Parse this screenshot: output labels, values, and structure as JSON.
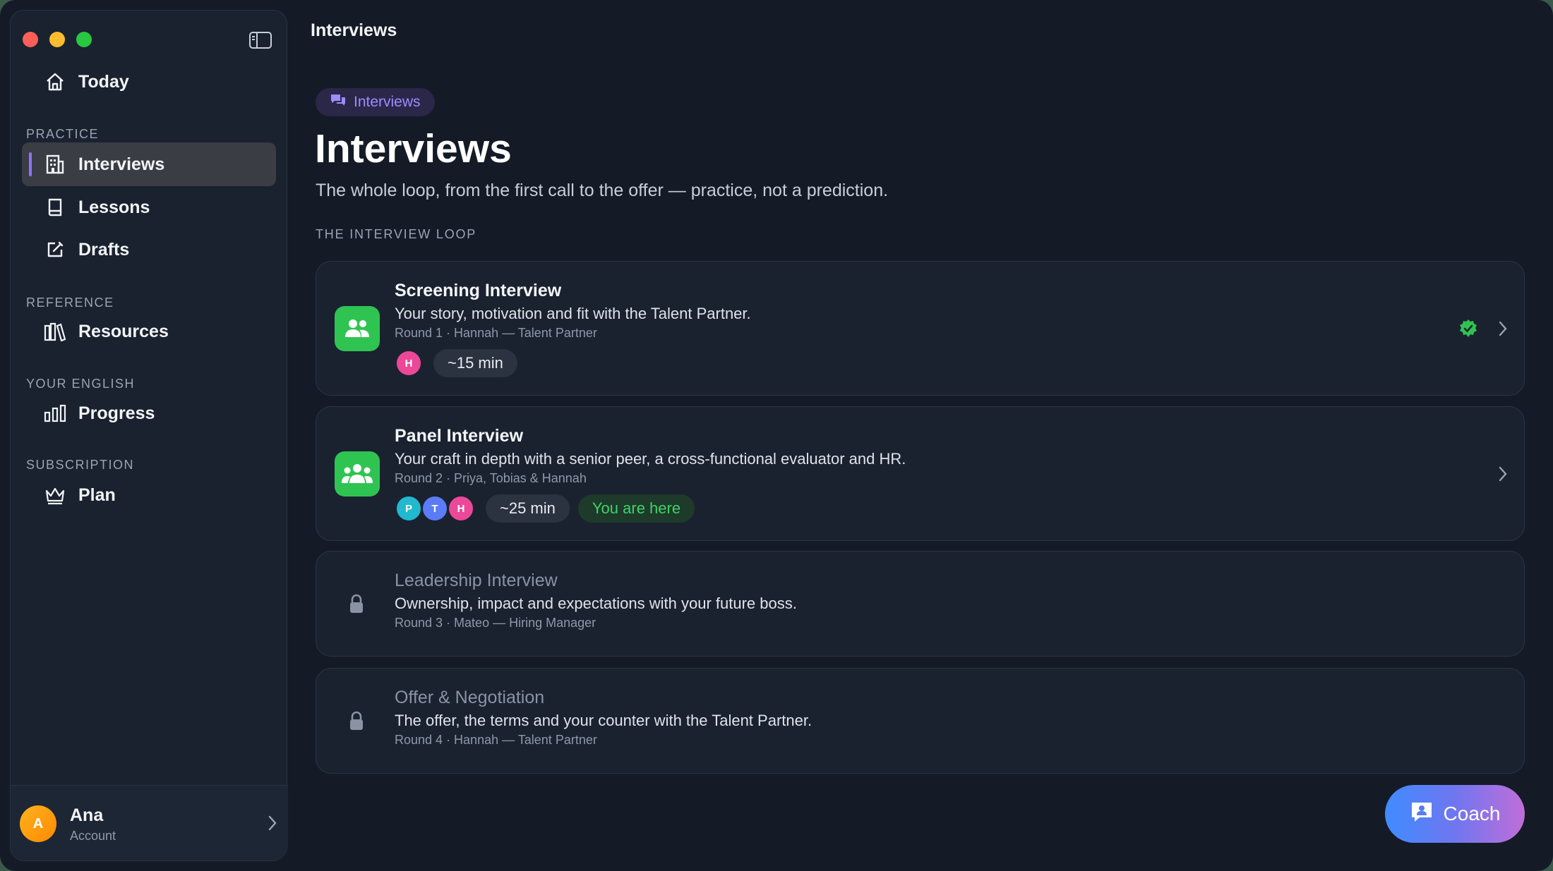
{
  "window": {
    "title": "Interviews"
  },
  "sidebar": {
    "today": "Today",
    "sections": {
      "practice": "PRACTICE",
      "reference": "REFERENCE",
      "your_english": "YOUR ENGLISH",
      "subscription": "SUBSCRIPTION"
    },
    "items": {
      "interviews": "Interviews",
      "lessons": "Lessons",
      "drafts": "Drafts",
      "resources": "Resources",
      "progress": "Progress",
      "plan": "Plan"
    },
    "account": {
      "initial": "A",
      "name": "Ana",
      "sub": "Account"
    }
  },
  "main": {
    "chip": "Interviews",
    "title": "Interviews",
    "subtitle": "The whole loop, from the first call to the offer — practice, not a prediction.",
    "loop_label": "THE INTERVIEW LOOP",
    "cards": [
      {
        "title": "Screening Interview",
        "desc": "Your story, motivation and fit with the Talent Partner.",
        "meta": "Round 1 · Hannah — Talent Partner",
        "avatars": [
          "H"
        ],
        "duration": "~15 min",
        "status": "completed"
      },
      {
        "title": "Panel Interview",
        "desc": "Your craft in depth with a senior peer, a cross-functional evaluator and HR.",
        "meta": "Round 2 · Priya, Tobias & Hannah",
        "avatars": [
          "P",
          "T",
          "H"
        ],
        "duration": "~25 min",
        "badge": "You are here"
      },
      {
        "title": "Leadership Interview",
        "desc": "Ownership, impact and expectations with your future boss.",
        "meta": "Round 3 · Mateo — Hiring Manager",
        "status": "locked"
      },
      {
        "title": "Offer & Negotiation",
        "desc": "The offer, the terms and your counter with the Talent Partner.",
        "meta": "Round 4 · Hannah — Talent Partner",
        "status": "locked"
      }
    ],
    "coach_label": "Coach"
  },
  "colors": {
    "accent": "#8e72ff",
    "success": "#2fc451",
    "avatar_pink": "#ec4899",
    "avatar_teal": "#22b8cf",
    "avatar_blue": "#5b7cf7"
  }
}
